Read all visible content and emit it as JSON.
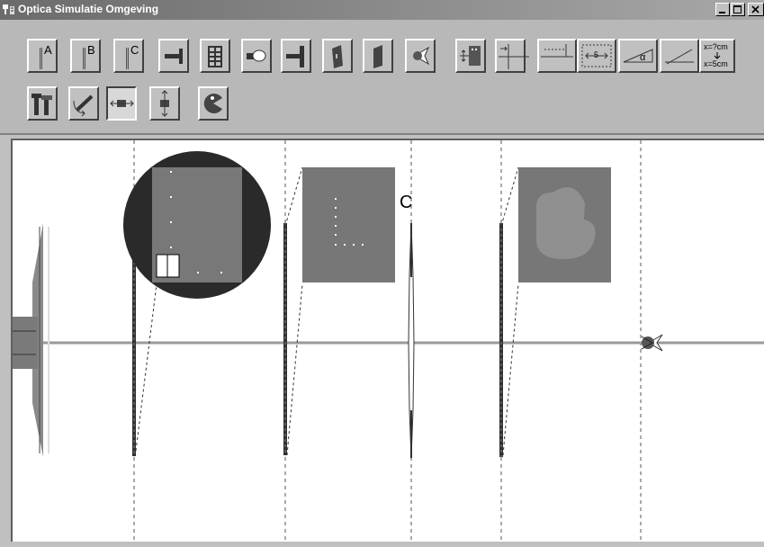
{
  "window": {
    "title": "Optica Simulatie Omgeving",
    "controls": [
      "minimize-icon",
      "maximize-icon",
      "close-icon"
    ]
  },
  "toolbar": {
    "row1": [
      {
        "name": "lens-a-button",
        "label": "A",
        "icon": "lens-a-icon"
      },
      {
        "name": "lens-b-button",
        "label": "B",
        "icon": "lens-b-icon"
      },
      {
        "name": "lens-c-button",
        "label": "C",
        "icon": "lens-c-icon"
      },
      {
        "name": "screen-button",
        "icon": "screen-icon"
      },
      {
        "name": "grid-object-button",
        "icon": "grid-object-icon"
      },
      {
        "name": "lamp-button",
        "icon": "lamp-icon"
      },
      {
        "name": "diaphragm-button",
        "icon": "diaphragm-icon"
      },
      {
        "name": "prism-button",
        "icon": "slab-icon"
      },
      {
        "name": "plate-button",
        "icon": "plate-icon"
      },
      {
        "name": "eye-button",
        "icon": "eye-icon"
      },
      {
        "name": "object-image-button",
        "icon": "object-image-icon"
      },
      {
        "name": "focus-marker-button",
        "icon": "focus-marker-icon"
      },
      {
        "name": "distance-marker-button",
        "icon": "distance-marker-icon"
      },
      {
        "name": "measure-button",
        "icon": "measure-icon",
        "label": "5"
      },
      {
        "name": "angle-button",
        "icon": "angle-icon",
        "label": "α"
      },
      {
        "name": "ray-button",
        "icon": "ray-icon"
      },
      {
        "name": "calculate-button",
        "icon": "calculate-icon",
        "top_label": "x=?cm",
        "bottom_label": "x=5cm"
      }
    ],
    "row2": [
      {
        "name": "tools-button",
        "icon": "tools-icon"
      },
      {
        "name": "rotate-button",
        "icon": "rotate-icon"
      },
      {
        "name": "move-horizontal-button",
        "icon": "horizontal-arrows-icon",
        "pressed": true
      },
      {
        "name": "move-vertical-button",
        "icon": "vertical-arrows-icon"
      },
      {
        "name": "exit-button",
        "icon": "pacman-icon"
      }
    ]
  },
  "canvas": {
    "lens_label": "C",
    "colors": {
      "axis": "#9a9a9a",
      "lens": "#303030",
      "image_panel": "#777777",
      "magnifier": "#2a2a2a",
      "dots": "#ffffff"
    }
  }
}
